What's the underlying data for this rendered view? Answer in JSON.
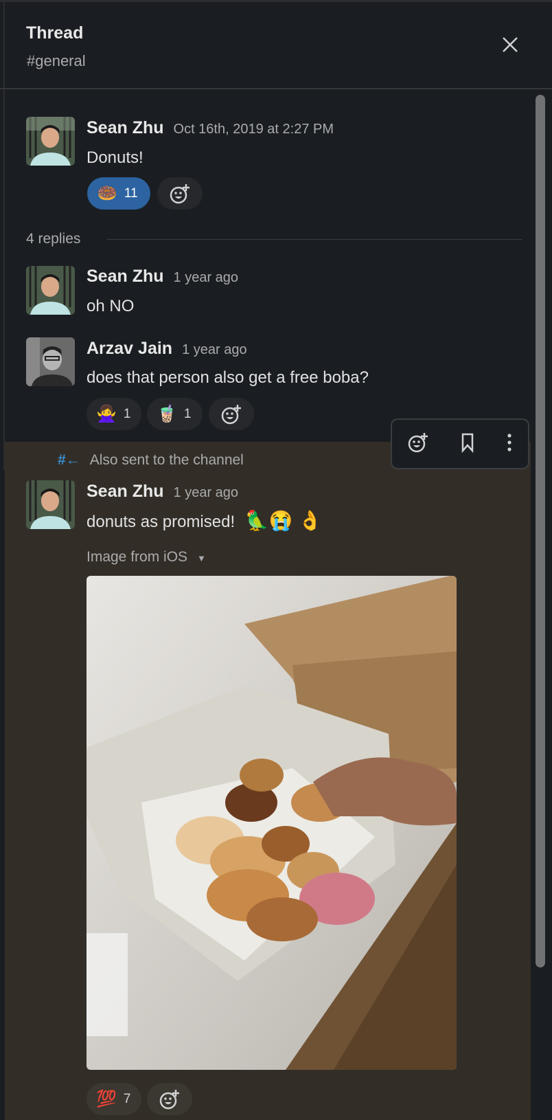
{
  "header": {
    "title": "Thread",
    "channel": "#general"
  },
  "parent": {
    "author": "Sean Zhu",
    "timestamp": "Oct 16th, 2019 at 2:27 PM",
    "text": "Donuts!",
    "reactions": [
      {
        "emoji": "🍩",
        "count": "11",
        "active": true
      }
    ]
  },
  "replies_label": "4 replies",
  "replies": [
    {
      "author": "Sean Zhu",
      "timestamp": "1 year ago",
      "text": "oh NO"
    },
    {
      "author": "Arzav Jain",
      "timestamp": "1 year ago",
      "text": "does that person also get a free boba?",
      "reactions": [
        {
          "emoji": "🙅‍♀️",
          "count": "1"
        },
        {
          "emoji": "🧋",
          "count": "1"
        }
      ]
    },
    {
      "also_sent": "Also sent to the channel",
      "author": "Sean Zhu",
      "timestamp": "1 year ago",
      "text": "donuts as promised!",
      "emojis": "🦜😭 👌",
      "attachment_label": "Image from iOS",
      "reactions": [
        {
          "emoji": "💯",
          "count": "7"
        }
      ]
    }
  ],
  "icons": {
    "close": "close-icon",
    "add_reaction": "add-reaction-icon",
    "bookmark": "bookmark-icon",
    "more": "more-vertical-icon",
    "shared": "hash-arrow-icon",
    "dropdown": "caret-down-icon"
  },
  "colors": {
    "accent": "#2c63a0",
    "highlight": "#322e27",
    "shared_icon": "#3a8fd1"
  }
}
